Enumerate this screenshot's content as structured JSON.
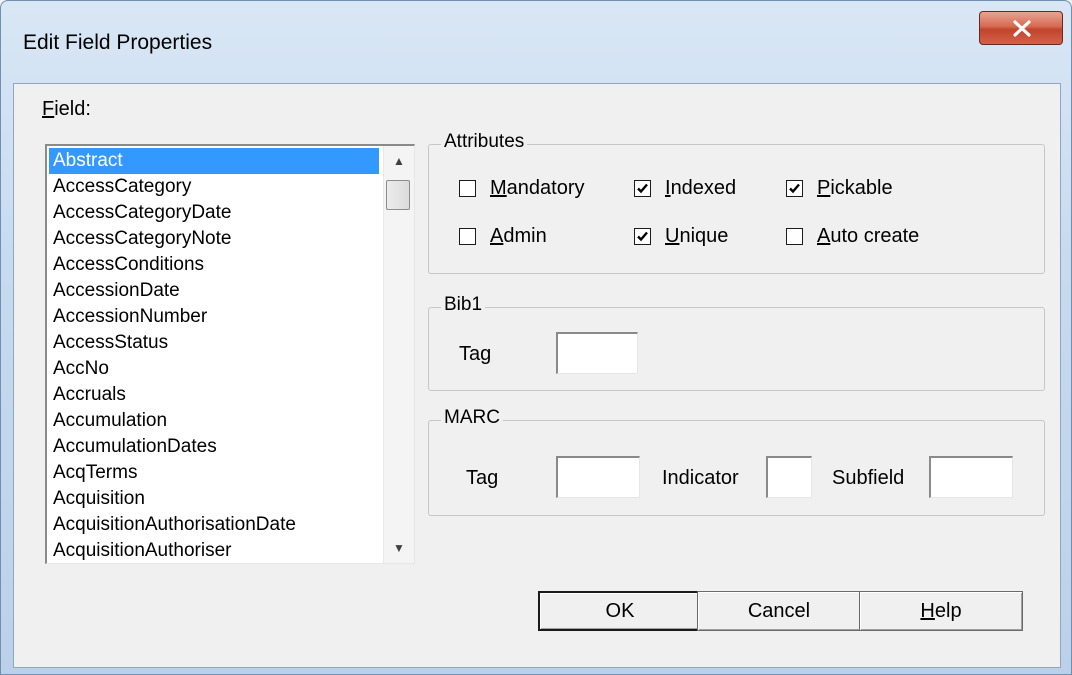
{
  "window": {
    "title": "Edit Field Properties",
    "close_glyph": "X"
  },
  "field": {
    "label_mnemonic": "F",
    "label_rest": "ield:",
    "items": [
      "Abstract",
      "AccessCategory",
      "AccessCategoryDate",
      "AccessCategoryNote",
      "AccessConditions",
      "AccessionDate",
      "AccessionNumber",
      "AccessStatus",
      "AccNo",
      "Accruals",
      "Accumulation",
      "AccumulationDates",
      "AcqTerms",
      "Acquisition",
      "AcquisitionAuthorisationDate",
      "AcquisitionAuthoriser"
    ],
    "selected": "Abstract"
  },
  "attributes": {
    "title": "Attributes",
    "mandatory": {
      "mn": "M",
      "rest": "andatory",
      "checked": false
    },
    "indexed": {
      "mn": "I",
      "rest": "ndexed",
      "checked": true
    },
    "pickable": {
      "mn": "P",
      "rest": "ickable",
      "checked": true
    },
    "admin": {
      "mn": "A",
      "rest": "dmin",
      "checked": false
    },
    "unique": {
      "mn": "U",
      "rest": "nique",
      "checked": true
    },
    "auto_create": {
      "mn": "A",
      "rest": "uto create",
      "checked": false
    }
  },
  "bib1": {
    "title": "Bib1",
    "tag_label": "Tag",
    "tag_value": ""
  },
  "marc": {
    "title": "MARC",
    "tag_label": "Tag",
    "tag_value": "",
    "indicator_label": "Indicator",
    "indicator_value": "",
    "subfield_label": "Subfield",
    "subfield_value": ""
  },
  "buttons": {
    "ok": "OK",
    "cancel": "Cancel",
    "help_mn": "H",
    "help_rest": "elp"
  }
}
